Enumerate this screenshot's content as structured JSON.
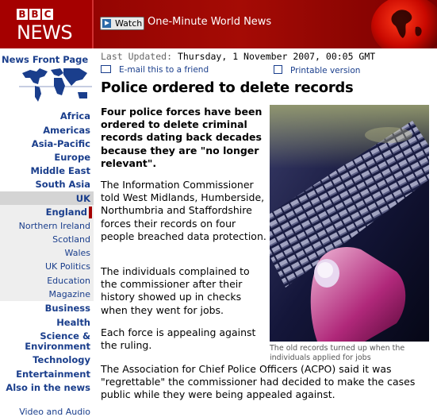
{
  "header": {
    "logo_letters": [
      "B",
      "B",
      "C"
    ],
    "logo_news": "NEWS",
    "watch_label": "Watch",
    "one_minute": "One-Minute World News"
  },
  "nav": {
    "front_page": "News Front Page",
    "regions": [
      "Africa",
      "Americas",
      "Asia-Pacific",
      "Europe",
      "Middle East",
      "South Asia"
    ],
    "uk": "UK",
    "uk_sub_bold": "England",
    "uk_sub": [
      "Northern Ireland",
      "Scotland",
      "Wales",
      "UK Politics",
      "Education",
      "Magazine"
    ],
    "sections": [
      "Business",
      "Health",
      "Science &",
      "Environment",
      "Technology",
      "Entertainment",
      "Also in the news"
    ],
    "video": "Video and Audio"
  },
  "article": {
    "updated_label": "Last Updated:",
    "updated_date": "Thursday, 1 November 2007, 00:05 GMT",
    "email": "E-mail this to a friend",
    "print": "Printable version",
    "headline": "Police ordered to delete records",
    "lead": "Four police forces have been ordered to delete criminal records dating back decades because they are \"no longer relevant\".",
    "p1": "The Information Commissioner told West Midlands, Humberside, Northumbria and Staffordshire forces their records on four people breached data protection.",
    "p2": "The individuals complained to the commissioner after their history showed up in checks when they went for jobs.",
    "p3": "Each force is appealing against the ruling.",
    "p4": "The Association for Chief Police Officers (ACPO) said it was \"regrettable\" the commissioner had decided to make the cases public while they were being appealed against.",
    "caption": "The old records turned up when the individuals applied for jobs"
  },
  "colors": {
    "brand_red": "#a50000",
    "link_blue": "#1a3e8c"
  }
}
